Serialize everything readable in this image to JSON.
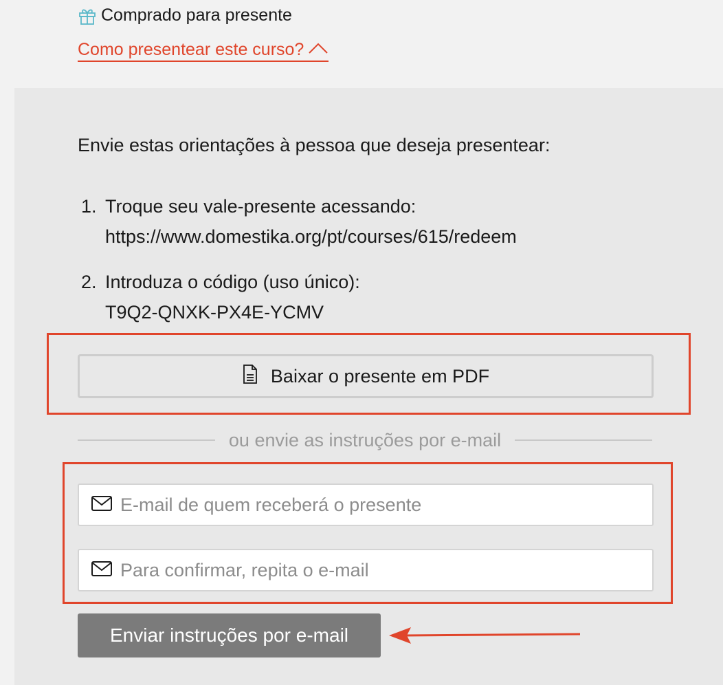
{
  "gift_status": {
    "label": "Comprado para presente",
    "icon": "gift-icon"
  },
  "howto_link": {
    "label": "Como presentear este curso?",
    "icon": "chevron-up-icon"
  },
  "instructions": {
    "intro": "Envie estas orientações à pessoa que deseja presentear:",
    "steps": [
      {
        "number": "1.",
        "text": "Troque seu vale-presente acessando:",
        "detail": "https://www.domestika.org/pt/courses/615/redeem"
      },
      {
        "number": "2.",
        "text": "Introduza o código (uso único):",
        "detail": "T9Q2-QNXK-PX4E-YCMV"
      }
    ]
  },
  "pdf_button": {
    "label": "Baixar o presente em PDF",
    "icon": "document-icon"
  },
  "divider_text": "ou envie as instruções por e-mail",
  "email_form": {
    "recipient": {
      "placeholder": "E-mail de quem receberá o presente",
      "value": "",
      "icon": "envelope-icon"
    },
    "confirm": {
      "placeholder": "Para confirmar, repita o e-mail",
      "value": "",
      "icon": "envelope-icon"
    },
    "submit_label": "Enviar instruções por e-mail"
  },
  "colors": {
    "accent": "#e0452b",
    "panel_bg": "#e8e8e8",
    "page_bg": "#f2f2f2",
    "submit_bg": "#7b7b7b",
    "gift_icon": "#5bb8c9"
  }
}
